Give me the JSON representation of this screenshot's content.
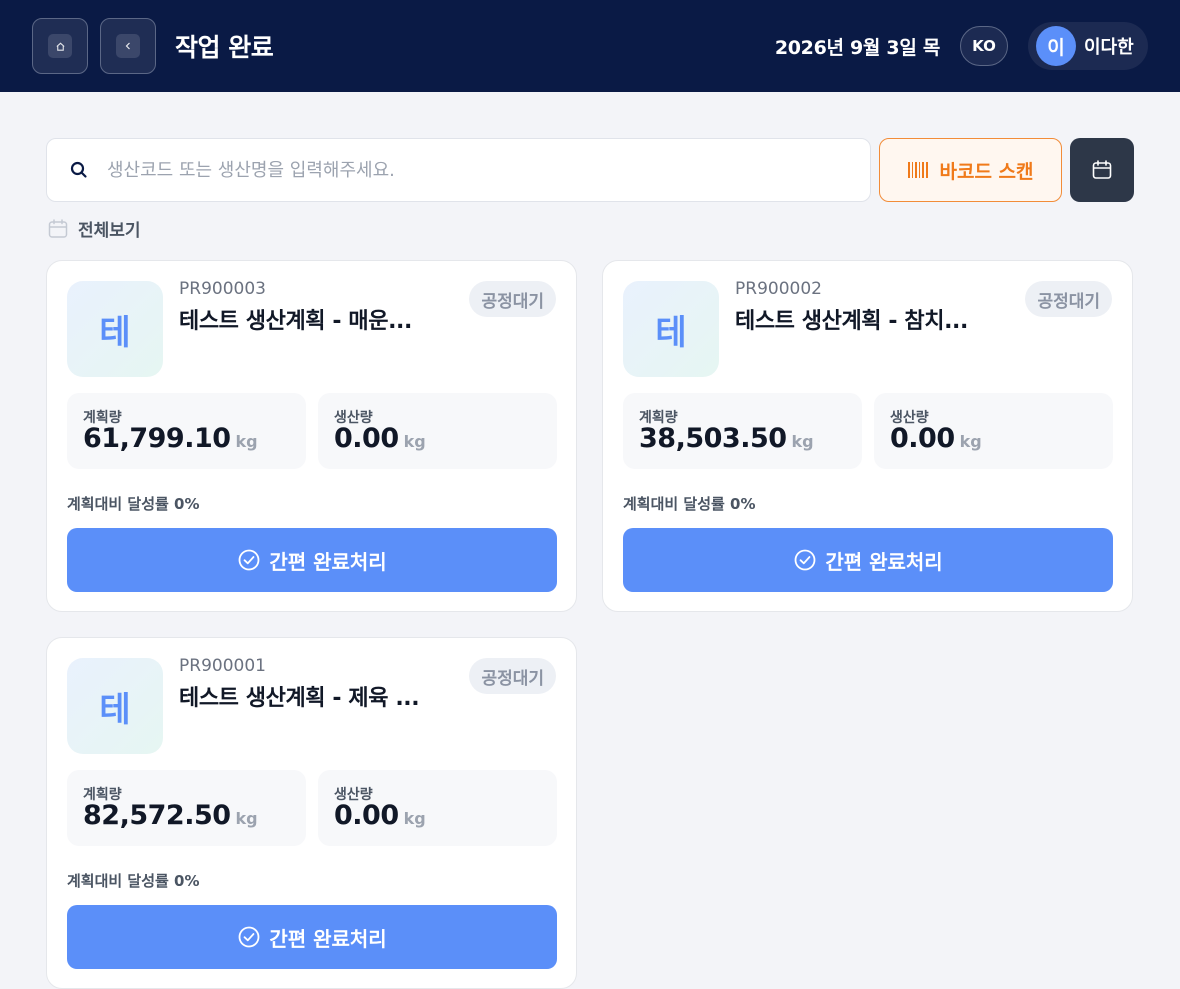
{
  "header": {
    "title": "작업 완료",
    "date": "2026년 9월 3일 목",
    "lang": "KO",
    "user": {
      "initial": "이",
      "name": "이다한"
    }
  },
  "search": {
    "placeholder": "생산코드 또는 생산명을 입력해주세요.",
    "value": ""
  },
  "toolbar": {
    "barcode_label": "바코드 스캔",
    "view_all_label": "전체보기"
  },
  "labels": {
    "planned": "계획량",
    "produced": "생산량",
    "unit": "kg",
    "complete_button": "간편 완료처리"
  },
  "cards": [
    {
      "initial": "테",
      "code": "PR900003",
      "name": "테스트 생산계획 - 매운...",
      "status": "공정대기",
      "planned": "61,799.10",
      "produced": "0.00",
      "rate": "계획대비 달성률 0%"
    },
    {
      "initial": "테",
      "code": "PR900002",
      "name": "테스트 생산계획 - 참치...",
      "status": "공정대기",
      "planned": "38,503.50",
      "produced": "0.00",
      "rate": "계획대비 달성률 0%"
    },
    {
      "initial": "테",
      "code": "PR900001",
      "name": "테스트 생산계획 - 제육 ...",
      "status": "공정대기",
      "planned": "82,572.50",
      "produced": "0.00",
      "rate": "계획대비 달성률 0%"
    }
  ],
  "colors": {
    "header_bg": "#0a1a45",
    "accent": "#5b8ff9",
    "barcode_accent": "#f07a1a",
    "status_bg": "#edf0f5"
  }
}
